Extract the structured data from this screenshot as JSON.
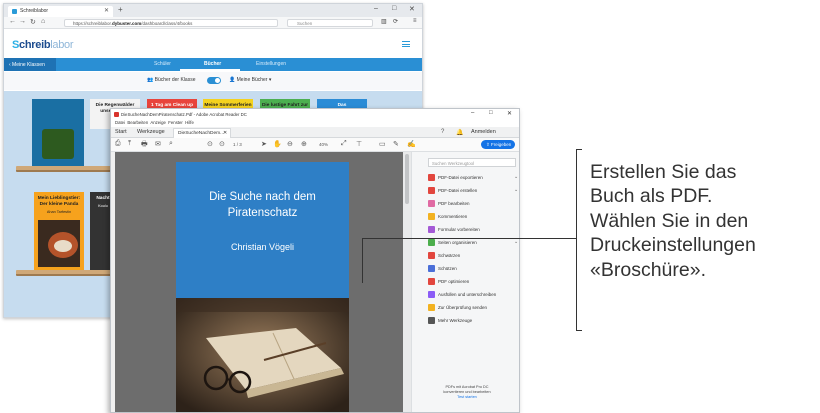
{
  "browser": {
    "tab_title": "Schreiblabor",
    "url_prefix": "https://schreiblabor.",
    "url_domain": "dybuster.com",
    "url_path": "/dashboard/class/4/books",
    "search_placeholder": "Suchen"
  },
  "app": {
    "logo_prefix": "S",
    "logo_main": "chreib",
    "logo_suffix": "labor",
    "back_label": "‹ Meine Klassen",
    "nav_tabs": [
      {
        "label": "Schüler",
        "active": false
      },
      {
        "label": "Bücher",
        "active": true
      },
      {
        "label": "Einstellungen",
        "active": false
      }
    ],
    "toggle_left": "Bücher der Klasse",
    "toggle_right": "Meine Bücher ▾",
    "books": [
      {
        "title": "",
        "color": "#1a6fa3"
      },
      {
        "title": "Die Regenwälder unserer Erde",
        "color": "#f3f3f3"
      },
      {
        "title": "1 Tag am Clean up Day",
        "color": "#e8443c"
      },
      {
        "title": "Meine Sommerferien",
        "color": "#f4d21f"
      },
      {
        "title": "Die lustige Fahrt zur Schule",
        "color": "#4caf50"
      },
      {
        "title": "Das Geburtstagskonzert",
        "color": "#2b8cd6"
      },
      {
        "title": "Mein Lieblingstier: Der kleine Panda",
        "subtitle": "Ahan Tarfestin",
        "color": "#f6a21d"
      },
      {
        "title": "Nacht",
        "subtitle": "Koulu",
        "color": "#333333"
      }
    ]
  },
  "acrobat": {
    "title": "DieSucheNachDemPiratenschatz.Pdf - Adobe Acrobat Reader DC",
    "menu": [
      "Datei",
      "Bearbeiten",
      "Anzeige",
      "Fenster",
      "Hilfe"
    ],
    "tabs": [
      "Start",
      "Werkzeuge"
    ],
    "doc_tab": "DieSucheNachDem...",
    "signin": "Anmelden",
    "share_label": "Freigeben",
    "page_info": "1 / 3",
    "zoom": "40%",
    "search_placeholder": "Suchen Werkzeugtool",
    "tools": [
      {
        "label": "PDF-Datei exportieren",
        "color": "#e2463e",
        "chevron": true
      },
      {
        "label": "PDF-Datei erstellen",
        "color": "#e2463e",
        "chevron": true
      },
      {
        "label": "PDF bearbeiten",
        "color": "#e06aa3",
        "chevron": false
      },
      {
        "label": "Kommentieren",
        "color": "#f2b221",
        "chevron": false
      },
      {
        "label": "Formular vorbereiten",
        "color": "#a45ad6",
        "chevron": false
      },
      {
        "label": "Seiten organisieren",
        "color": "#4cae4c",
        "chevron": true
      },
      {
        "label": "Schwärzen",
        "color": "#e2463e",
        "chevron": false
      },
      {
        "label": "Schützen",
        "color": "#4b6fd8",
        "chevron": false
      },
      {
        "label": "PDF optimieren",
        "color": "#e2463e",
        "chevron": false
      },
      {
        "label": "Ausfüllen und unterschreiben",
        "color": "#8b5cf6",
        "chevron": false
      },
      {
        "label": "Zur Überprüfung senden",
        "color": "#f2b221",
        "chevron": false
      },
      {
        "label": "Mehr Werkzeuge",
        "color": "#555555",
        "chevron": false
      }
    ],
    "footer_line1": "PDFs mit Acrobat Pro DC",
    "footer_line2": "konvertieren und bearbeiten",
    "footer_link": "Test starten"
  },
  "pdf_page": {
    "title_line1": "Die Suche nach dem",
    "title_line2": "Piratenschatz",
    "author": "Christian Vögeli"
  },
  "callout": {
    "lines": [
      "Erstellen Sie das",
      "Buch als PDF.",
      "Wählen Sie in den",
      "Druckeinstellungen",
      "«Broschüre»."
    ]
  }
}
